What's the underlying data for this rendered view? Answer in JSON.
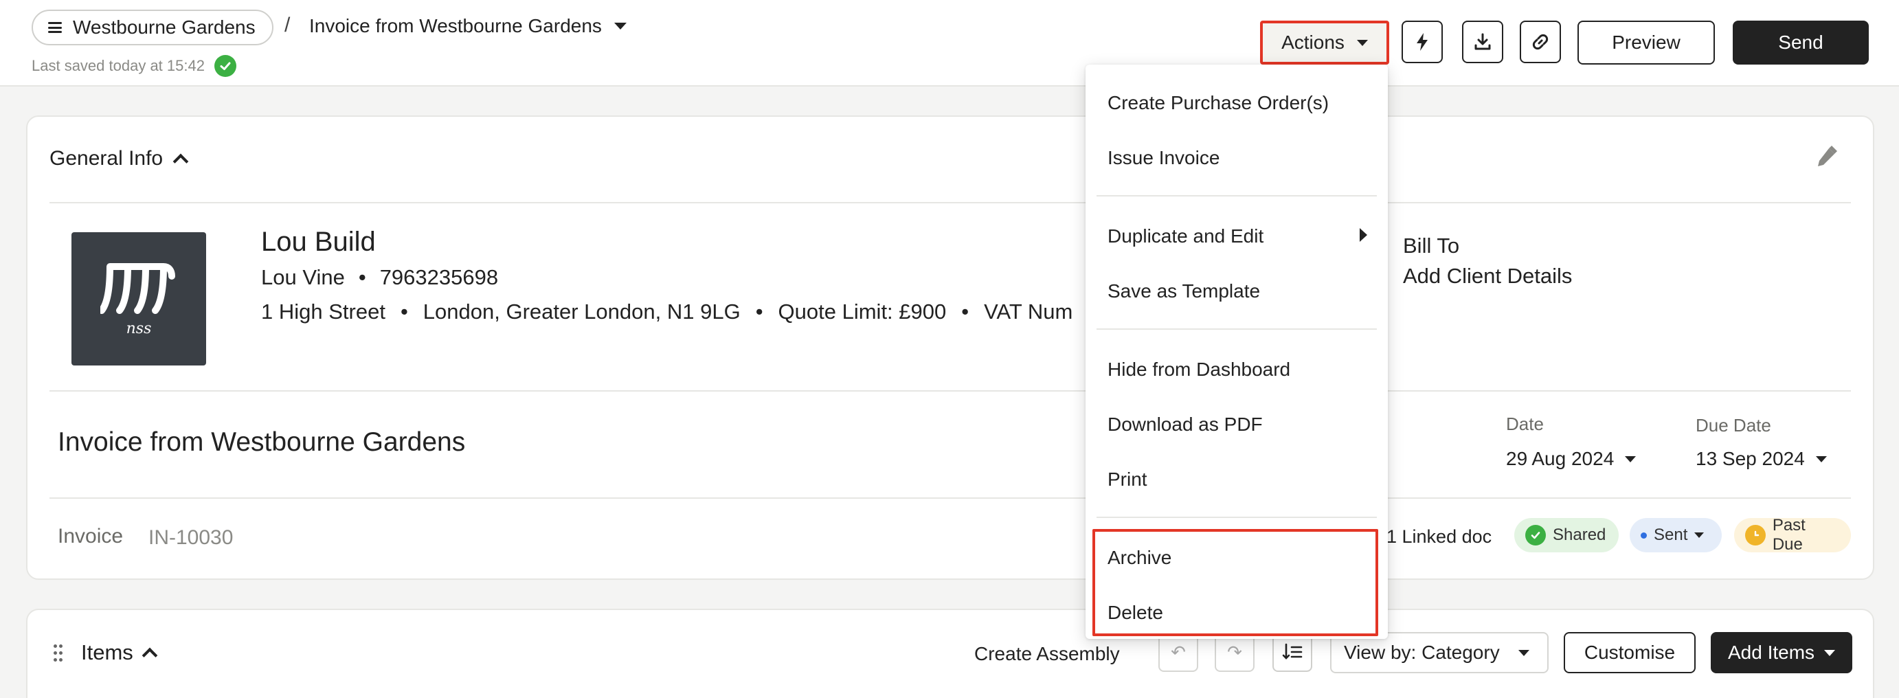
{
  "header": {
    "workspace": "Westbourne Gardens",
    "separator": "/",
    "document_title": "Invoice from Westbourne Gardens",
    "saved_status": "Last saved today at 15:42",
    "actions_label": "Actions",
    "preview_label": "Preview",
    "send_label": "Send",
    "icons": [
      "lightning-icon",
      "download-icon",
      "link-icon"
    ]
  },
  "general_info": {
    "title": "General Info",
    "company": {
      "name": "Lou Build",
      "contact_name": "Lou Vine",
      "bullet": "•",
      "phone": "7963235698",
      "address": "1 High Street",
      "city": "London, Greater London, N1 9LG",
      "quote_limit": "Quote Limit: £900",
      "vat": "VAT Num",
      "logo_text": "nss"
    },
    "bill_to_label": "Bill To",
    "bill_to_value": "Add Client Details",
    "invoice_heading": "Invoice from Westbourne Gardens",
    "date_label": "Date",
    "date_value": "29 Aug 2024",
    "due_date_label": "Due Date",
    "due_date_value": "13 Sep 2024",
    "doc_type": "Invoice",
    "doc_number": "IN-10030",
    "linked_docs": "1 Linked doc",
    "badges": {
      "shared": "Shared",
      "sent": "Sent",
      "past_due": "Past Due"
    },
    "colors": {
      "shared": "#3cb043",
      "sent": "#2f6fe0",
      "past_due": "#f0b429"
    }
  },
  "items_bar": {
    "title": "Items",
    "create_assembly": "Create Assembly",
    "view_by": "View by: Category",
    "customise": "Customise",
    "add_items": "Add Items"
  },
  "actions_menu": {
    "items": [
      "Create Purchase Order(s)",
      "Issue Invoice",
      "Duplicate and Edit",
      "Save as Template",
      "Hide from Dashboard",
      "Download as PDF",
      "Print",
      "Archive",
      "Delete"
    ]
  },
  "colors": {
    "highlight": "#e33626",
    "primary_dark": "#222222"
  }
}
